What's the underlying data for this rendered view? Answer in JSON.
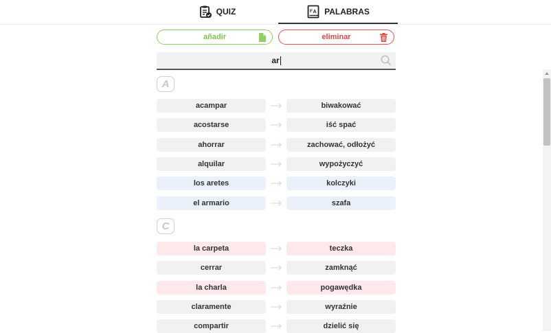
{
  "tabs": [
    {
      "label": "QUIZ",
      "icon": "quiz-clipboard-icon",
      "active": false
    },
    {
      "label": "PALABRAS",
      "icon": "dictionary-book-icon",
      "active": true
    }
  ],
  "actions": {
    "add_label": "añadir",
    "add_icon": "document-icon",
    "add_color": "#7cc346",
    "delete_label": "eliminar",
    "delete_icon": "trash-icon",
    "delete_color": "#e04848"
  },
  "search": {
    "value": "ar",
    "icon": "search-icon"
  },
  "sections": [
    {
      "letter": "A",
      "words": [
        {
          "es": "acampar",
          "pl": "biwakować",
          "tint": "none"
        },
        {
          "es": "acostarse",
          "pl": "iść spać",
          "tint": "none"
        },
        {
          "es": "ahorrar",
          "pl": "zachować, odłożyć",
          "tint": "none"
        },
        {
          "es": "alquilar",
          "pl": "wypożyczyć",
          "tint": "none"
        },
        {
          "es": "los aretes",
          "pl": "kolczyki",
          "tint": "blue"
        },
        {
          "es": "el armario",
          "pl": "szafa",
          "tint": "blue"
        }
      ]
    },
    {
      "letter": "C",
      "words": [
        {
          "es": "la carpeta",
          "pl": "teczka",
          "tint": "pink"
        },
        {
          "es": "cerrar",
          "pl": "zamknąć",
          "tint": "none"
        },
        {
          "es": "la charla",
          "pl": "pogawędka",
          "tint": "pink"
        },
        {
          "es": "claramente",
          "pl": "wyraźnie",
          "tint": "none"
        },
        {
          "es": "compartir",
          "pl": "dzielić się",
          "tint": "none"
        }
      ]
    }
  ],
  "colors": {
    "blue_tint": "#eaf1fb",
    "pink_tint": "#fde8ec",
    "neutral": "#f1f1f1"
  }
}
